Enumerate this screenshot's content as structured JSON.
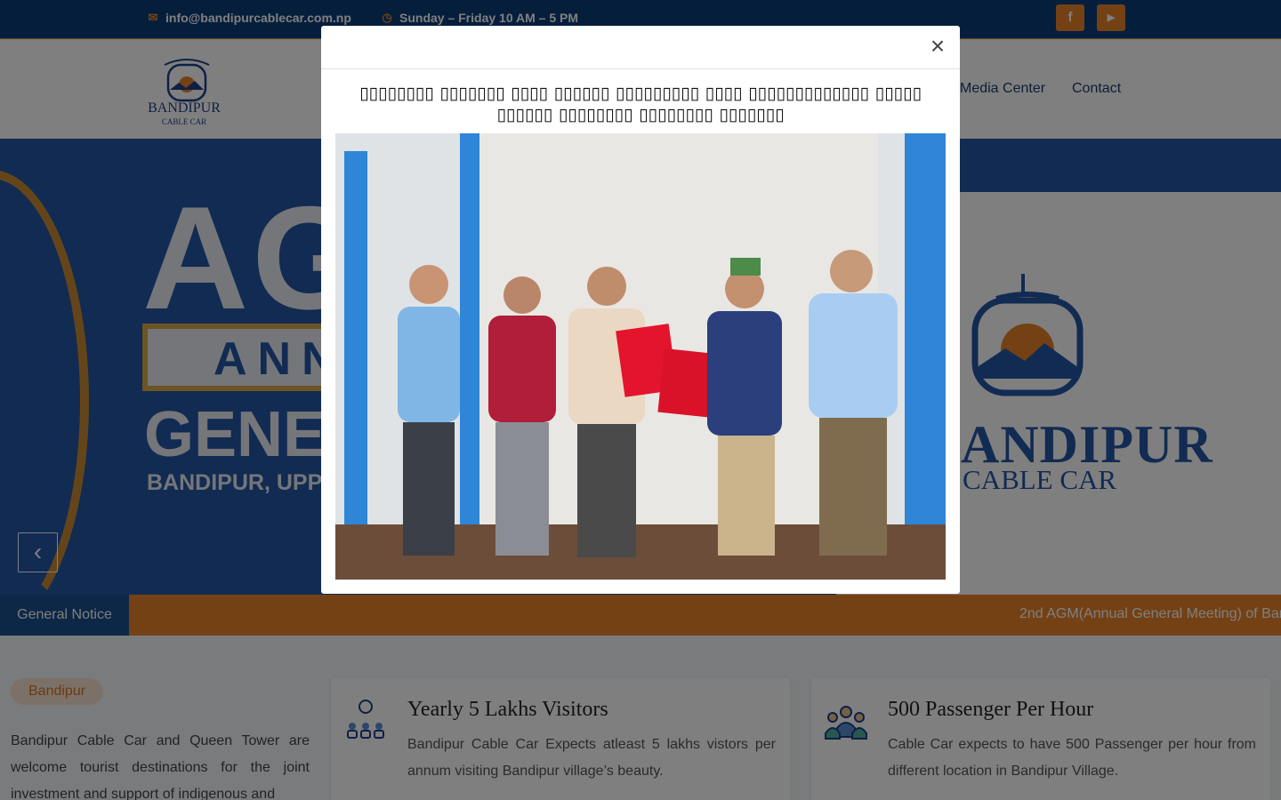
{
  "topbar": {
    "email": "info@bandipurcablecar.com.np",
    "hours": "Sunday – Friday 10 AM – 5 PM",
    "social": [
      {
        "icon": "facebook-icon",
        "label": "f"
      },
      {
        "icon": "youtube-icon",
        "label": "▶"
      }
    ]
  },
  "nav": {
    "logo_text": "BANDIPUR",
    "logo_sub": "CABLE CAR",
    "items": [
      "Media Center",
      "Contact"
    ]
  },
  "hero": {
    "big": "AG",
    "line2": "ANN",
    "line3": "GENE",
    "line4": "BANDIPUR, UPP",
    "brand": "ANDIPUR",
    "brand_sub": "CABLE CAR"
  },
  "notice": {
    "label": "General Notice",
    "ticker": "2nd AGM(Annual General Meeting) of Bar"
  },
  "content": {
    "pill": "Bandipur",
    "intro": "Bandipur Cable Car and Queen Tower are welcome tourist destinations for the joint investment and support of indigenous and",
    "features": [
      {
        "icon": "visitors-icon",
        "title": "Yearly 5 Lakhs Visitors",
        "desc": "Bandipur Cable Car Expects atleast 5 lakhs vistors per annum visiting Bandipur village’s beauty."
      },
      {
        "icon": "passengers-icon",
        "title": "500 Passenger Per Hour",
        "desc": "Cable Car expects to have 500 Passenger per hour from different location in Bandipur Village."
      }
    ]
  },
  "modal": {
    "title": "▯▯▯▯▯▯▯▯ ▯▯▯▯▯▯▯ ▯▯▯▯ ▯▯▯▯▯▯ ▯▯▯▯▯▯▯▯▯ ▯▯▯▯ ▯▯▯▯▯▯▯▯▯▯▯▯▯ ▯▯▯▯▯ ▯▯▯▯▯▯ ▯▯▯▯▯▯▯▯ ▯▯▯▯▯▯▯▯ ▯▯▯▯▯▯▯",
    "close": "×"
  },
  "colors": {
    "topbar": "#0a3d78",
    "accent": "#e8822a",
    "hero": "#2556a6"
  }
}
